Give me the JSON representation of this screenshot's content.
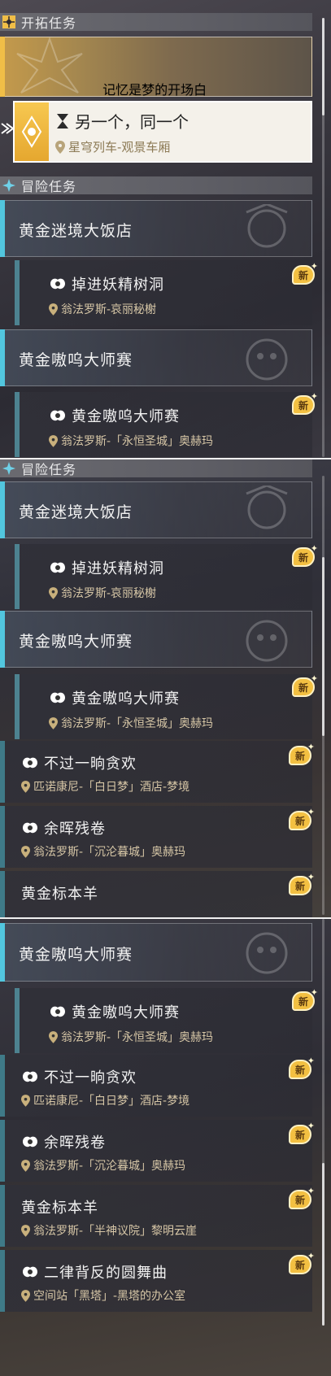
{
  "colors": {
    "gold_accent": "#f0be47",
    "blue_accent": "#52c6de",
    "teal_accent": "#3d8c99",
    "location_text": "#d6c6a6",
    "new_badge": "#f3c042"
  },
  "panel1": {
    "trailblaze_header": "开拓任务",
    "mission_gold": "记忆是梦的开场白",
    "mission_selected": {
      "title": "另一个，同一个",
      "location": "星穹列车-观景车厢"
    },
    "adventure_header": "冒险任务",
    "card1_title": "黄金迷境大饭店",
    "quest1": {
      "title": "掉进妖精树洞",
      "location": "翁法罗斯-哀丽秘榭",
      "badge": "新"
    },
    "card2_title": "黄金嗷呜大师赛",
    "quest2": {
      "title": "黄金嗷呜大师赛",
      "location": "翁法罗斯-「永恒圣城」奥赫玛",
      "badge": "新"
    }
  },
  "panel2": {
    "adventure_header": "冒险任务",
    "card1_title": "黄金迷境大饭店",
    "quest1": {
      "title": "掉进妖精树洞",
      "location": "翁法罗斯-哀丽秘榭",
      "badge": "新"
    },
    "card2_title": "黄金嗷呜大师赛",
    "quest2": {
      "title": "黄金嗷呜大师赛",
      "location": "翁法罗斯-「永恒圣城」奥赫玛",
      "badge": "新"
    },
    "quest3": {
      "title": "不过一晌贪欢",
      "location": "匹诺康尼-「白日梦」酒店-梦境",
      "badge": "新"
    },
    "quest4": {
      "title": "余晖残卷",
      "location": "翁法罗斯-「沉沦暮城」奥赫玛",
      "badge": "新"
    },
    "quest5": {
      "title": "黄金标本羊",
      "badge": "新"
    }
  },
  "panel3": {
    "card_title": "黄金嗷呜大师赛",
    "quest1": {
      "title": "黄金嗷呜大师赛",
      "location": "翁法罗斯-「永恒圣城」奥赫玛",
      "badge": "新"
    },
    "quest2": {
      "title": "不过一晌贪欢",
      "location": "匹诺康尼-「白日梦」酒店-梦境",
      "badge": "新"
    },
    "quest3": {
      "title": "余晖残卷",
      "location": "翁法罗斯-「沉沦暮城」奥赫玛",
      "badge": "新"
    },
    "quest4": {
      "title": "黄金标本羊",
      "location": "翁法罗斯-「半神议院」黎明云崖",
      "badge": "新"
    },
    "quest5": {
      "title": "二律背反的圆舞曲",
      "location": "空间站「黑塔」-黑塔的办公室",
      "badge": "新"
    }
  }
}
